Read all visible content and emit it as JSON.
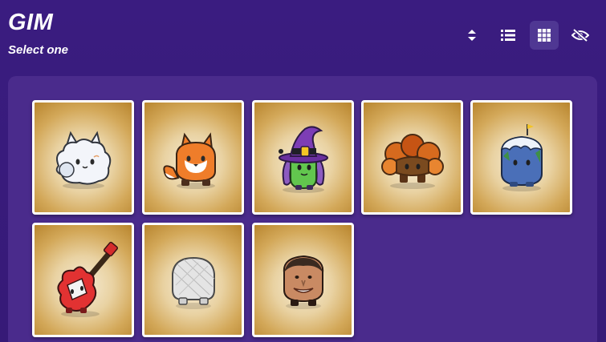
{
  "header": {
    "title": "GIM",
    "subtitle": "Select one"
  },
  "toolbar": {
    "buttons": [
      {
        "name": "sort-icon"
      },
      {
        "name": "list-view-icon"
      },
      {
        "name": "grid-view-icon",
        "active": true
      },
      {
        "name": "eye-off-icon"
      }
    ]
  },
  "gims": [
    {
      "name": "white-fluffy-cat"
    },
    {
      "name": "orange-fox"
    },
    {
      "name": "purple-witch"
    },
    {
      "name": "autumn-bush"
    },
    {
      "name": "mountain-rock"
    },
    {
      "name": "red-guitar"
    },
    {
      "name": "gray-sketch-blob"
    },
    {
      "name": "smiling-face"
    }
  ],
  "colors": {
    "background": "#371b7a",
    "panel": "#4a2b8c",
    "active_button": "#4f3793",
    "card_border": "#ffffff"
  }
}
